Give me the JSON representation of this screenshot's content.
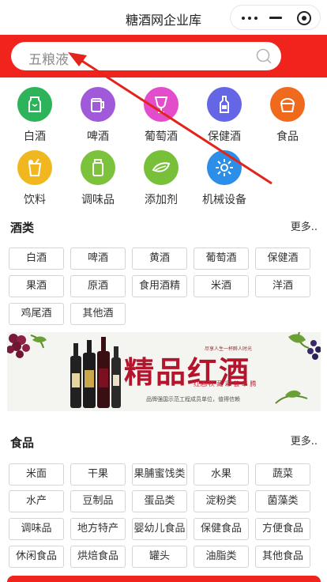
{
  "nav": {
    "title": "糖酒网企业库"
  },
  "search": {
    "placeholder": "五粮液"
  },
  "categories": [
    {
      "label": "白酒",
      "icon": "baijiu-icon",
      "color": "#2db35a"
    },
    {
      "label": "啤酒",
      "icon": "beer-icon",
      "color": "#a05ad9"
    },
    {
      "label": "葡萄酒",
      "icon": "wine-glass-icon",
      "color": "#e34ccb"
    },
    {
      "label": "保健酒",
      "icon": "bottle-icon",
      "color": "#6466e6"
    },
    {
      "label": "食品",
      "icon": "bread-icon",
      "color": "#f06a1e"
    },
    {
      "label": "饮料",
      "icon": "drink-icon",
      "color": "#f0b81e"
    },
    {
      "label": "调味品",
      "icon": "condiment-icon",
      "color": "#7dc23c"
    },
    {
      "label": "添加剂",
      "icon": "leaf-icon",
      "color": "#78c03a"
    },
    {
      "label": "机械设备",
      "icon": "gear-icon",
      "color": "#2d8ee8"
    }
  ],
  "liquor_section": {
    "title": "酒类",
    "more": "更多..",
    "tags": [
      "白酒",
      "啤酒",
      "黄酒",
      "葡萄酒",
      "保健酒",
      "果酒",
      "原酒",
      "食用酒精",
      "米酒",
      "洋酒",
      "鸡尾酒",
      "其他酒"
    ]
  },
  "banner": {
    "title": "精品红酒",
    "subtitle": "红酒/秩 藏 彩 荟 串 腾",
    "top_text": "尽享人生一杯醉人时光",
    "footer": "品牌强国示范工程成员单位，值得信赖"
  },
  "food_section": {
    "title": "食品",
    "more": "更多..",
    "tags": [
      "米面",
      "干果",
      "果脯蜜饯类",
      "水果",
      "蔬菜",
      "水产",
      "豆制品",
      "蛋品类",
      "淀粉类",
      "菌藻类",
      "调味品",
      "地方特产",
      "婴幼儿食品",
      "保健食品",
      "方便食品",
      "休闲食品",
      "烘焙食品",
      "罐头",
      "油脂类",
      "其他食品"
    ]
  }
}
